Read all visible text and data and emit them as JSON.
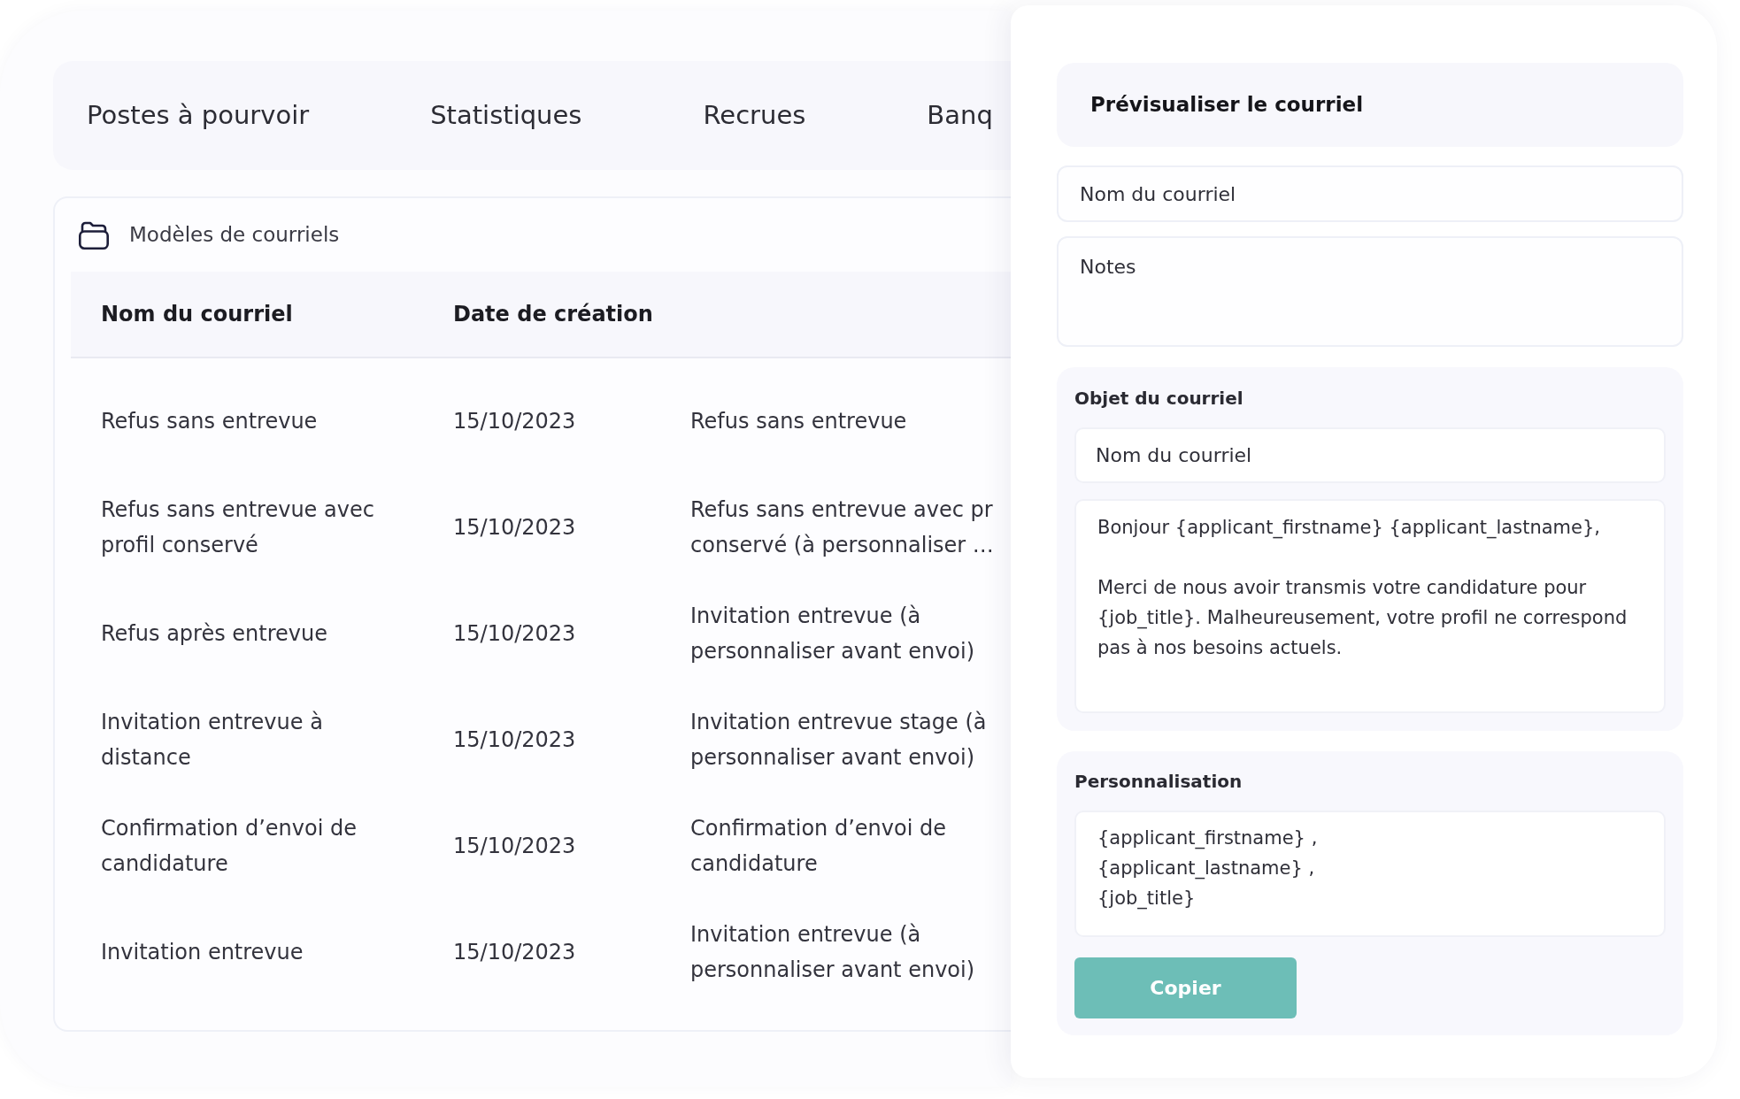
{
  "nav": {
    "tabs": [
      {
        "label": "Postes à pourvoir"
      },
      {
        "label": "Statistiques"
      },
      {
        "label": "Recrues"
      },
      {
        "label": "Banq"
      }
    ]
  },
  "templates": {
    "title": "Modèles de courriels",
    "columns": [
      "Nom du courriel",
      "Date de création"
    ],
    "rows": [
      {
        "name": "Refus sans entrevue",
        "date": "15/10/2023",
        "column_3": "Refus sans entrevue"
      },
      {
        "name": "Refus sans entrevue avec\nprofil conservé",
        "date": "15/10/2023",
        "column_3": "Refus sans entrevue avec pr\nconservé (à personnaliser …"
      },
      {
        "name": "Refus après entrevue",
        "date": "15/10/2023",
        "column_3": "Invitation entrevue (à\npersonnaliser avant envoi)"
      },
      {
        "name": "Invitation entrevue à\ndistance",
        "date": "15/10/2023",
        "column_3": "Invitation entrevue stage (à\npersonnaliser avant envoi)"
      },
      {
        "name": "Confirmation d’envoi de\ncandidature",
        "date": "15/10/2023",
        "column_3": "Confirmation d’envoi de\ncandidature"
      },
      {
        "name": "Invitation entrevue",
        "date": "15/10/2023",
        "column_3": "Invitation entrevue (à\npersonnaliser avant envoi)"
      }
    ]
  },
  "preview": {
    "title": "Prévisualiser le courriel",
    "name_field": {
      "placeholder": "Nom du courriel"
    },
    "notes_field": {
      "placeholder": "Notes"
    },
    "subject_section": {
      "label": "Objet du courriel",
      "subject_field": {
        "placeholder": "Nom du courriel"
      },
      "body_field": {
        "value": "Bonjour {applicant_firstname} {applicant_lastname},\n\nMerci de nous avoir transmis votre candidature pour\n{job_title}. Malheureusement, votre profil ne correspond\npas à nos besoins actuels."
      }
    },
    "personalization": {
      "label": "Personnalisation",
      "field": {
        "value": "{applicant_firstname} ,\n{applicant_lastname} ,\n{job_title}"
      }
    },
    "copy_button": "Copier"
  }
}
